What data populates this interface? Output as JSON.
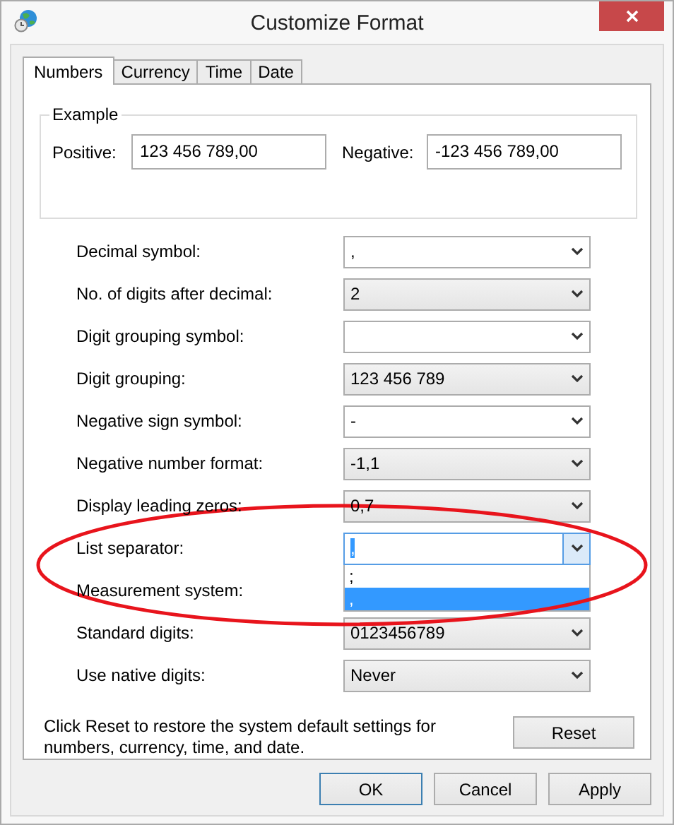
{
  "window": {
    "title": "Customize Format"
  },
  "tabs": [
    {
      "label": "Numbers",
      "selected": true
    },
    {
      "label": "Currency",
      "selected": false
    },
    {
      "label": "Time",
      "selected": false
    },
    {
      "label": "Date",
      "selected": false
    }
  ],
  "example": {
    "title": "Example",
    "positive_label": "Positive:",
    "positive_value": "123 456 789,00",
    "negative_label": "Negative:",
    "negative_value": "-123 456 789,00"
  },
  "settings": [
    {
      "label": "Decimal symbol:",
      "kind": "editable",
      "value": ","
    },
    {
      "label": "No. of digits after decimal:",
      "kind": "list",
      "value": "2"
    },
    {
      "label": "Digit grouping symbol:",
      "kind": "editable"
    },
    {
      "label": "Digit grouping:",
      "kind": "list",
      "value": "123 456 789"
    },
    {
      "label": "Negative sign symbol:",
      "kind": "editable",
      "value": "-"
    },
    {
      "label": "Negative number format:",
      "kind": "list",
      "value": "-1,1"
    },
    {
      "label": "Display leading zeros:",
      "kind": "list",
      "value": "0,7"
    },
    {
      "label": "List separator:",
      "kind": "editable",
      "value": ",",
      "expanded": true,
      "options": [
        {
          "text": ";",
          "selected": false
        },
        {
          "text": ",",
          "selected": true
        }
      ]
    },
    {
      "label": "Measurement system:",
      "kind": "hidden"
    },
    {
      "label": "Standard digits:",
      "kind": "list",
      "value": "0123456789"
    },
    {
      "label": "Use native digits:",
      "kind": "list",
      "value": "Never"
    }
  ],
  "reset": {
    "note": "Click Reset to restore the system default settings for numbers, currency, time, and date.",
    "button": "Reset"
  },
  "buttons": [
    {
      "label": "OK",
      "default": true
    },
    {
      "label": "Cancel",
      "default": false
    },
    {
      "label": "Apply",
      "default": false
    }
  ],
  "annotation": {
    "kind": "ellipse"
  }
}
